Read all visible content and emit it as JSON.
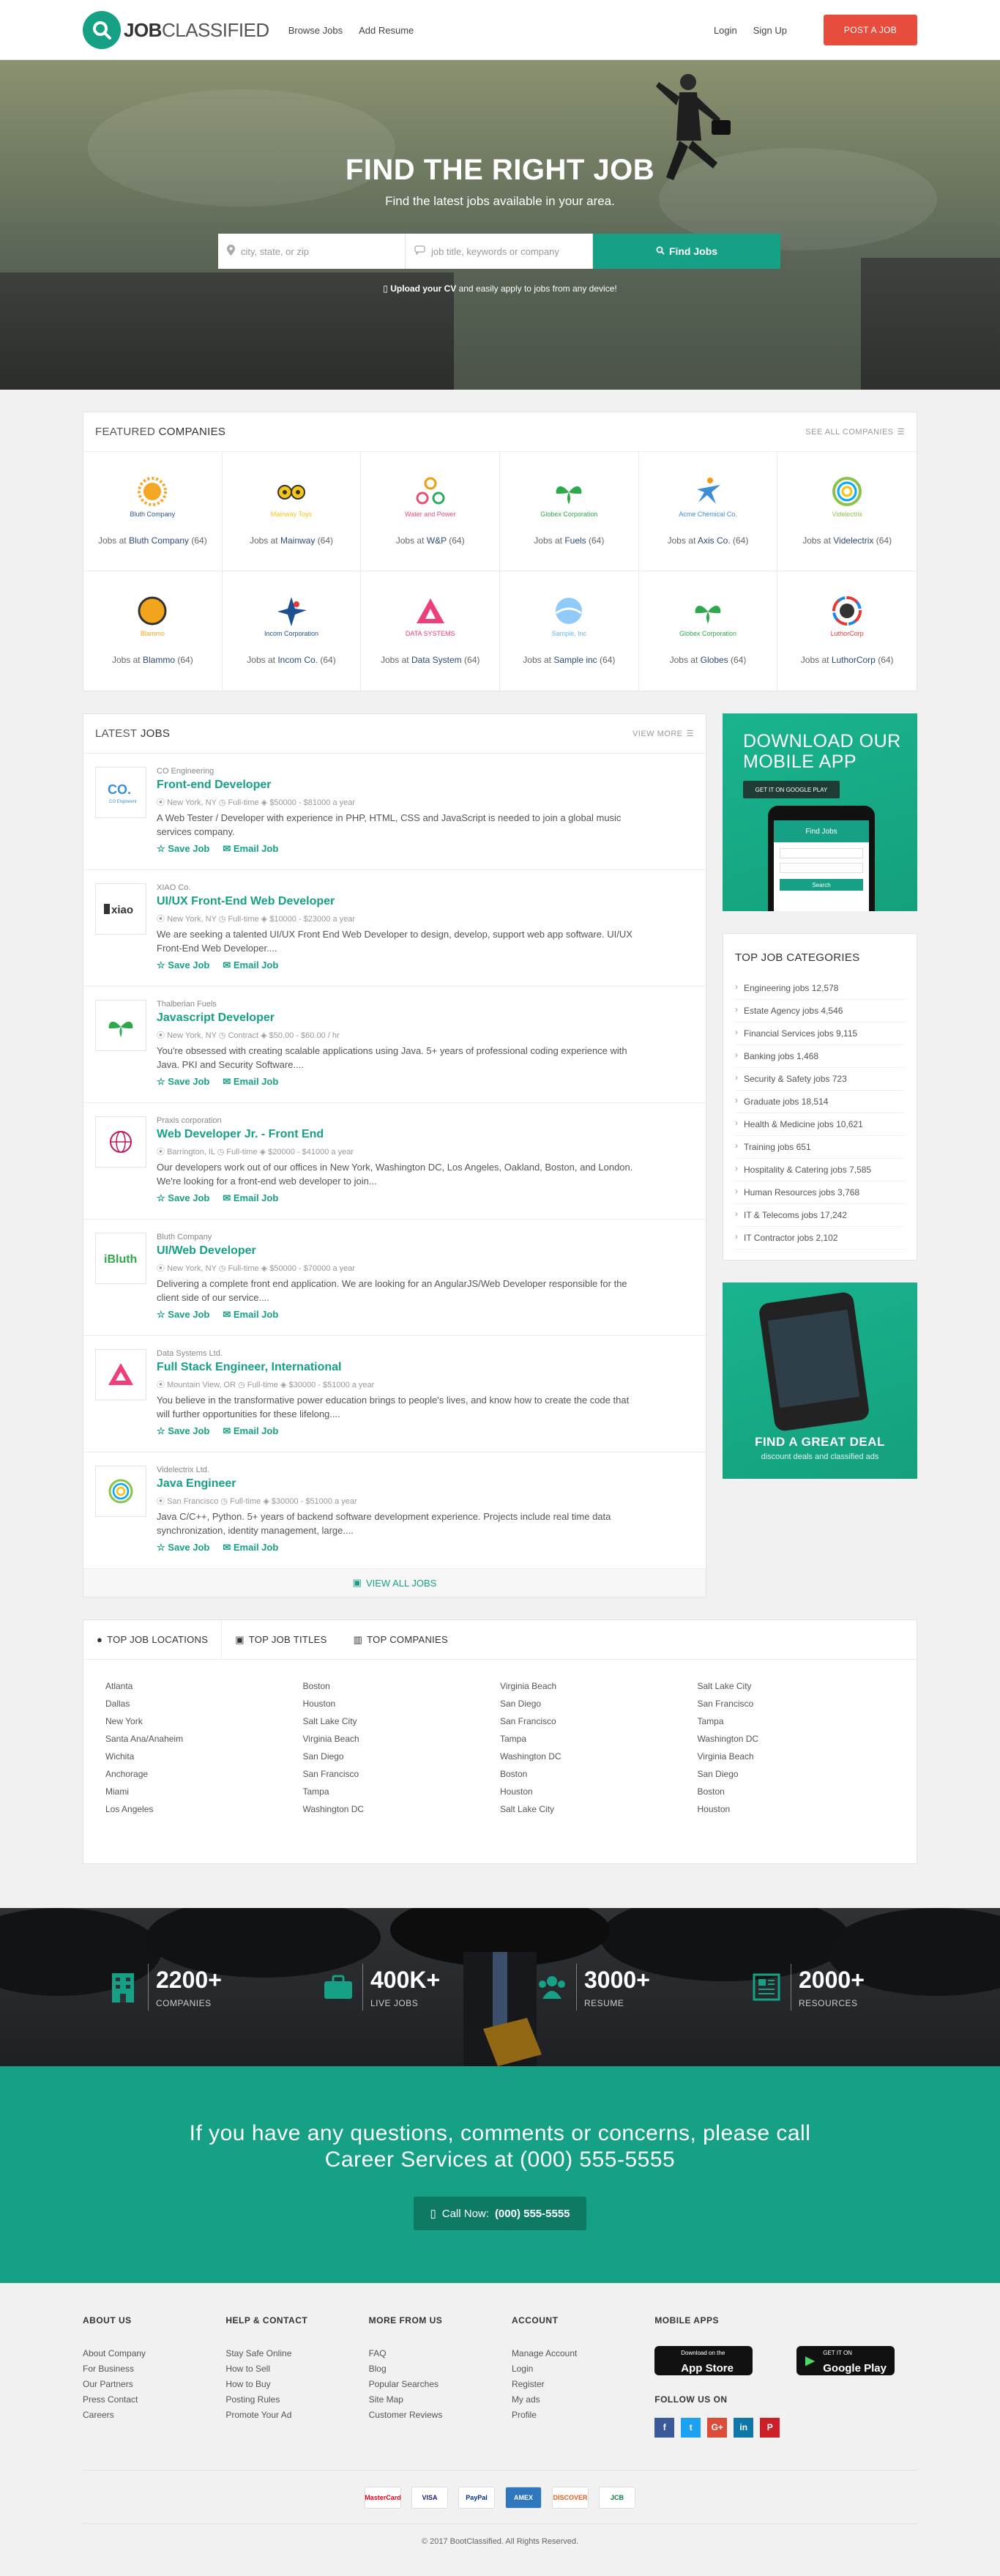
{
  "header": {
    "logo_text_bold": "JOB",
    "logo_text": "CLASSIFIED",
    "nav": [
      "Browse Jobs",
      "Add Resume"
    ],
    "login": "Login",
    "signup": "Sign Up",
    "post_job": "POST A JOB"
  },
  "hero": {
    "title": "FIND THE RIGHT JOB",
    "subtitle": "Find the latest jobs available in your area.",
    "location_placeholder": "city, state, or zip",
    "keyword_placeholder": "job title, keywords or company",
    "search_button": "Find Jobs",
    "upload_bold": "Upload your CV",
    "upload_rest": " and easily apply to jobs from any device!"
  },
  "featured": {
    "title_thin": "FEATURED",
    "title": "COMPANIES",
    "see_all": "SEE ALL COMPANIES",
    "caption_prefix": "Jobs at",
    "companies": [
      {
        "logo": "Bluth Company",
        "name": "Bluth Company",
        "count": "(64)",
        "color": "#f5a623"
      },
      {
        "logo": "Mainway Toys",
        "name": "Mainway",
        "count": "(64)",
        "color": "#f5c518"
      },
      {
        "logo": "Water and Power",
        "name": "W&P",
        "count": "(64)",
        "color": "#e94e77"
      },
      {
        "logo": "Globex Corporation",
        "name": "Fuels",
        "count": "(64)",
        "color": "#2ea84a"
      },
      {
        "logo": "Acme Chemical Co.",
        "name": "Axis Co.",
        "count": "(64)",
        "color": "#3b8ed8"
      },
      {
        "logo": "Videlectrix",
        "name": "Videlectrix",
        "count": "(64)",
        "color": "#8bc34a"
      },
      {
        "logo": "Blammo",
        "name": "Blammo",
        "count": "(64)",
        "color": "#f2a51a"
      },
      {
        "logo": "Incom Corporation",
        "name": "Incom Co.",
        "count": "(64)",
        "color": "#1d4f91"
      },
      {
        "logo": "DATA SYSTEMS",
        "name": "Data System",
        "count": "(64)",
        "color": "#ec407a"
      },
      {
        "logo": "Sample, Inc",
        "name": "Sample inc",
        "count": "(64)",
        "color": "#64b5f6"
      },
      {
        "logo": "Globex Corporation",
        "name": "Globes",
        "count": "(64)",
        "color": "#2ea84a"
      },
      {
        "logo": "LuthorCorp",
        "name": "LuthorCorp",
        "count": "(64)",
        "color": "#e53935"
      }
    ]
  },
  "latest": {
    "title_thin": "LATEST",
    "title": "JOBS",
    "view_more": "VIEW MORE",
    "save": "Save Job",
    "email": "Email Job",
    "view_all": "VIEW ALL JOBS",
    "jobs": [
      {
        "company": "CO Engineering",
        "title": "Front-end Developer",
        "location": "New York, NY",
        "type": "Full-time",
        "salary": "$50000 - $81000 a year",
        "desc": "A Web Tester / Developer with experience in PHP, HTML, CSS and JavaScript is needed to join a global music services company.",
        "logo": "CO."
      },
      {
        "company": "XIAO Co.",
        "title": "UI/UX Front-End Web Developer",
        "location": "New York, NY",
        "type": "Full-time",
        "salary": "$10000 - $23000 a year",
        "desc": "We are seeking a talented UI/UX Front End Web Developer to design, develop, support web app software. UI/UX Front-End Web Developer....",
        "logo": "xiao"
      },
      {
        "company": "Thalberian Fuels",
        "title": "Javascript Developer",
        "location": "New York, NY",
        "type": "Contract",
        "salary": "$50.00 - $60.00 / hr",
        "desc": "You're obsessed with creating scalable applications using Java. 5+ years of professional coding experience with Java. PKI and Security Software....",
        "logo": "leaf"
      },
      {
        "company": "Praxis corporation",
        "title": "Web Developer Jr. - Front End",
        "location": "Barrington, IL",
        "type": "Full-time",
        "salary": "$20000 - $41000 a year",
        "desc": "Our developers work out of our offices in New York, Washington DC, Los Angeles, Oakland, Boston, and London. We're looking for a front-end web developer to join...",
        "logo": "globe"
      },
      {
        "company": "Bluth Company",
        "title": "UI/Web Developer",
        "location": "New York, NY",
        "type": "Full-time",
        "salary": "$50000 - $70000 a year",
        "desc": "Delivering a complete front end application. We are looking for an AngularJS/Web Developer responsible for the client side of our service....",
        "logo": "iBluth"
      },
      {
        "company": "Data Systems Ltd.",
        "title": "Full Stack Engineer, International",
        "location": "Mountain View, OR",
        "type": "Full-time",
        "salary": "$30000 - $51000 a year",
        "desc": "You believe in the transformative power education brings to people's lives, and know how to create the code that will further opportunities for these lifelong....",
        "logo": "tri"
      },
      {
        "company": "Videlectrix Ltd.",
        "title": "Java Engineer",
        "location": "San Francisco",
        "type": "Full-time",
        "salary": "$30000 - $51000 a year",
        "desc": "Java C/C++, Python. 5+ years of backend software development experience. Projects include real time data synchronization, identity management, large....",
        "logo": "v"
      }
    ]
  },
  "app_promo": {
    "title": "DOWNLOAD OUR MOBILE APP",
    "google": "GET IT ON GOOGLE PLAY",
    "screen_title": "Find Jobs",
    "screen_button": "Search"
  },
  "categories": {
    "title": "TOP JOB CATEGORIES",
    "items": [
      "Engineering jobs 12,578",
      "Estate Agency jobs 4,546",
      "Financial Services jobs 9,115",
      "Banking jobs 1,468",
      "Security & Safety jobs 723",
      "Graduate jobs 18,514",
      "Health & Medicine jobs 10,621",
      "Training jobs 651",
      "Hospitality & Catering jobs 7,585",
      "Human Resources jobs 3,768",
      "IT & Telecoms jobs 17,242",
      "IT Contractor jobs 2,102"
    ]
  },
  "deal": {
    "title": "FIND A GREAT DEAL",
    "subtitle": "discount deals and classified ads"
  },
  "locations": {
    "tabs": [
      "TOP JOB LOCATIONS",
      "TOP JOB TITLES",
      "TOP COMPANIES"
    ],
    "columns": [
      [
        "Atlanta",
        "Dallas",
        "New York",
        "Santa Ana/Anaheim",
        "Wichita",
        "Anchorage",
        "Miami",
        "Los Angeles"
      ],
      [
        "Boston",
        "Houston",
        "Salt Lake City",
        "Virginia Beach",
        "San Diego",
        "San Francisco",
        "Tampa",
        "Washington DC"
      ],
      [
        "Virginia Beach",
        "San Diego",
        "San Francisco",
        "Tampa",
        "Washington DC",
        "Boston",
        "Houston",
        "Salt Lake City"
      ],
      [
        "Salt Lake City",
        "San Francisco",
        "Tampa",
        "Washington DC",
        "Virginia Beach",
        "San Diego",
        "Boston",
        "Houston"
      ]
    ]
  },
  "stats": [
    {
      "value": "2200+",
      "label": "COMPANIES",
      "icon": "building-icon"
    },
    {
      "value": "400K+",
      "label": "LIVE JOBS",
      "icon": "briefcase-icon"
    },
    {
      "value": "3000+",
      "label": "RESUME",
      "icon": "users-icon"
    },
    {
      "value": "2000+",
      "label": "RESOURCES",
      "icon": "newspaper-icon"
    }
  ],
  "contact": {
    "line1": "If you have any questions, comments or concerns, please call",
    "line2": "Career Services at (000) 555-5555",
    "call_label": "Call Now:",
    "call_number": "(000) 555-5555"
  },
  "footer": {
    "columns": [
      {
        "title": "ABOUT US",
        "links": [
          "About Company",
          "For Business",
          "Our Partners",
          "Press Contact",
          "Careers"
        ]
      },
      {
        "title": "HELP & CONTACT",
        "links": [
          "Stay Safe Online",
          "How to Sell",
          "How to Buy",
          "Posting Rules",
          "Promote Your Ad"
        ]
      },
      {
        "title": "MORE FROM US",
        "links": [
          "FAQ",
          "Blog",
          "Popular Searches",
          "Site Map",
          "Customer Reviews"
        ]
      },
      {
        "title": "ACCOUNT",
        "links": [
          "Manage Account",
          "Login",
          "Register",
          "My ads",
          "Profile"
        ]
      }
    ],
    "apps_title": "MOBILE APPS",
    "appstore_small": "Download on the",
    "appstore": "App Store",
    "googleplay_small": "GET IT ON",
    "googleplay": "Google Play",
    "follow": "FOLLOW US ON",
    "socials": [
      {
        "letter": "f",
        "color": "#3b5998"
      },
      {
        "letter": "t",
        "color": "#1da1f2"
      },
      {
        "letter": "G+",
        "color": "#dd4b39"
      },
      {
        "letter": "in",
        "color": "#0e76a8"
      },
      {
        "letter": "P",
        "color": "#cb2027"
      }
    ],
    "payments": [
      "MasterCard",
      "VISA",
      "PayPal",
      "AMEX",
      "DISCOVER",
      "JCB"
    ],
    "copyright": "© 2017 BootClassified. All Rights Reserved."
  },
  "colors": {
    "accent": "#16a085",
    "post": "#e74c3c",
    "link": "#2d4b73"
  }
}
